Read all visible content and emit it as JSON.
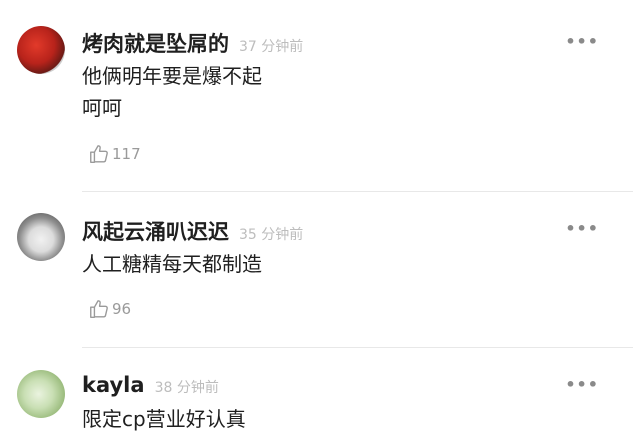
{
  "comments": [
    {
      "username": "烤肉就是坠屌的",
      "time": "37 分钟前",
      "lines": [
        "他俩明年要是爆不起",
        "呵呵"
      ],
      "likes": "117",
      "more": "•••"
    },
    {
      "username": "风起云涌叭迟迟",
      "time": "35 分钟前",
      "lines": [
        "人工糖精每天都制造"
      ],
      "likes": "96",
      "more": "•••"
    },
    {
      "username": "kayla",
      "time": "38 分钟前",
      "lines": [
        "限定cp营业好认真"
      ],
      "likes": "",
      "more": "•••"
    }
  ]
}
